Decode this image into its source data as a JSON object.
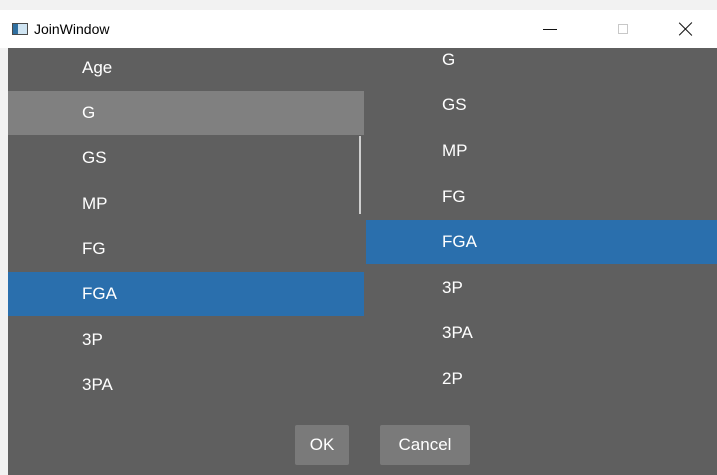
{
  "window": {
    "title": "JoinWindow"
  },
  "left_list": {
    "items": [
      "Age",
      "G",
      "GS",
      "MP",
      "FG",
      "FGA",
      "3P",
      "3PA"
    ],
    "hovered": "G",
    "selected": "FGA"
  },
  "right_list": {
    "items": [
      "G",
      "GS",
      "MP",
      "FG",
      "FGA",
      "3P",
      "3PA",
      "2P"
    ],
    "selected": "FGA"
  },
  "buttons": {
    "ok_label": "OK",
    "cancel_label": "Cancel"
  },
  "colors": {
    "background": "#5f5f5f",
    "selection": "#2a6fad",
    "hover": "#808080"
  }
}
